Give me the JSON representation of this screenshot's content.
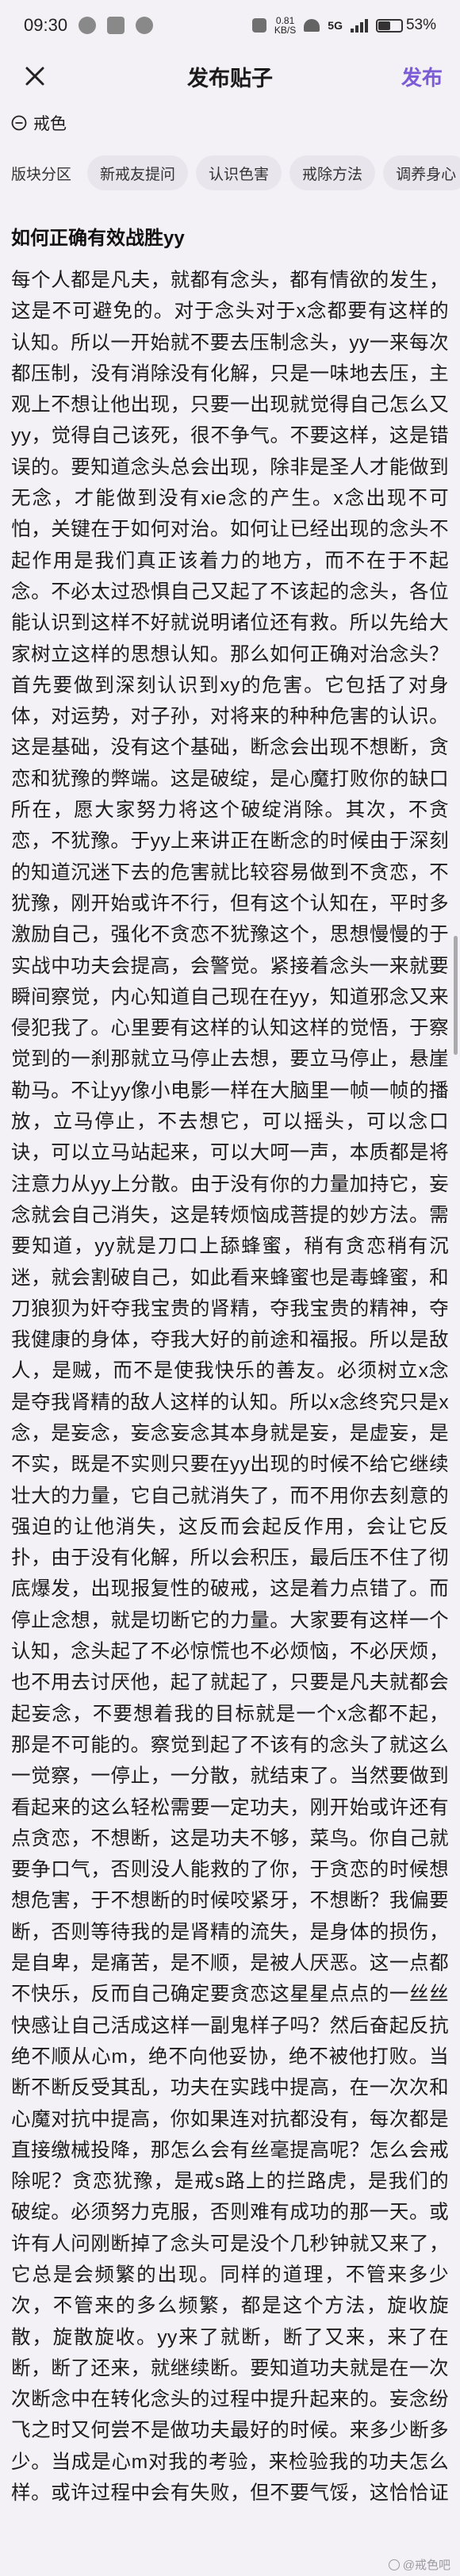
{
  "status_bar": {
    "time": "09:30",
    "net_speed_value": "0.81",
    "net_speed_unit": "KB/S",
    "network": "5G",
    "battery": "53%",
    "battery_level": 0.53
  },
  "header": {
    "title": "发布贴子",
    "publish_label": "发布"
  },
  "topic": {
    "label": "戒色"
  },
  "category": {
    "label": "版块分区",
    "chips": [
      "新戒友提问",
      "认识色害",
      "戒除方法",
      "调养身心"
    ]
  },
  "post": {
    "title": "如何正确有效战胜yy",
    "body": "每个人都是凡夫，就都有念头，都有情欲的发生，这是不可避免的。对于念头对于x念都要有这样的认知。所以一开始就不要去压制念头，yy一来每次都压制，没有消除没有化解，只是一味地去压，主观上不想让他出现，只要一出现就觉得自己怎么又yy，觉得自己该死，很不争气。不要这样，这是错误的。要知道念头总会出现，除非是圣人才能做到无念，才能做到没有xie念的产生。x念出现不可怕，关键在于如何对治。如何让已经出现的念头不起作用是我们真正该着力的地方，而不在于不起念。不必太过恐惧自己又起了不该起的念头，各位能认识到这样不好就说明诸位还有救。所以先给大家树立这样的思想认知。那么如何正确对治念头？首先要做到深刻认识到xy的危害。它包括了对身体，对运势，对子孙，对将来的种种危害的认识。这是基础，没有这个基础，断念会出现不想断，贪恋和犹豫的弊端。这是破绽，是心魔打败你的缺口所在，愿大家努力将这个破绽消除。其次，不贪恋，不犹豫。于yy上来讲正在断念的时候由于深刻的知道沉迷下去的危害就比较容易做到不贪恋，不犹豫，刚开始或许不行，但有这个认知在，平时多激励自己，强化不贪恋不犹豫这个，思想慢慢的于实战中功夫会提高，会警觉。紧接着念头一来就要瞬间察觉，内心知道自己现在在yy，知道邪念又来侵犯我了。心里要有这样的认知这样的觉悟，于察觉到的一刹那就立马停止去想，要立马停止，悬崖勒马。不让yy像小电影一样在大脑里一帧一帧的播放，立马停止，不去想它，可以摇头，可以念口诀，可以立马站起来，可以大呵一声，本质都是将注意力从yy上分散。由于没有你的力量加持它，妄念就会自己消失，这是转烦恼成菩提的妙方法。需要知道，yy就是刀口上舔蜂蜜，稍有贪恋稍有沉迷，就会割破自己，如此看来蜂蜜也是毒蜂蜜，和刀狼狈为奸夺我宝贵的肾精，夺我宝贵的精神，夺我健康的身体，夺我大好的前途和福报。所以是敌人，是贼，而不是使我快乐的善友。必须树立x念是夺我肾精的敌人这样的认知。所以x念终究只是x念，是妄念，妄念妄念其本身就是妄，是虚妄，是不实，既是不实则只要在yy出现的时候不给它继续壮大的力量，它自己就消失了，而不用你去刻意的强迫的让他消失，这反而会起反作用，会让它反扑，由于没有化解，所以会积压，最后压不住了彻底爆发，出现报复性的破戒，这是着力点错了。而停止念想，就是切断它的力量。大家要有这样一个认知，念头起了不必惊慌也不必烦恼，不必厌烦，也不用去讨厌他，起了就起了，只要是凡夫就都会起妄念，不要想着我的目标就是一个x念都不起，那是不可能的。察觉到起了不该有的念头了就这么一觉察，一停止，一分散，就结束了。当然要做到看起来的这么轻松需要一定功夫，刚开始或许还有点贪恋，不想断，这是功夫不够，菜鸟。你自己就要争口气，否则没人能救的了你，于贪恋的时候想想危害，于不想断的时候咬紧牙，不想断？我偏要断，否则等待我的是肾精的流失，是身体的损伤，是自卑，是痛苦，是不顺，是被人厌恶。这一点都不快乐，反而自己确定要贪恋这星星点点的一丝丝快感让自己活成这样一副鬼样子吗？然后奋起反抗绝不顺从心m，绝不向他妥协，绝不被他打败。当断不断反受其乱，功夫在实践中提高，在一次次和心魔对抗中提高，你如果连对抗都没有，每次都是直接缴械投降，那怎么会有丝毫提高呢？怎么会戒除呢？贪恋犹豫，是戒s路上的拦路虎，是我们的破绽。必须努力克服，否则难有成功的那一天。或许有人问刚断掉了念头可是没个几秒钟就又来了，它总是会频繁的出现。同样的道理，不管来多少次，不管来的多么频繁，都是这个方法，旋收旋散，旋散旋收。yy来了就断，断了又来，来了在断，断了还来，就继续断。要知道功夫就是在一次次断念中在转化念头的过程中提升起来的。妄念纷飞之时又何尝不是做功夫最好的时候。来多少断多少。当成是心m对我的考验，来检验我的功夫怎么样。或许过程中会有失败，但不要气馁，这恰恰证明你的功夫不够，振奋精神，于妄念纷飞中继续努力下去，时间一长功夫就得力。功夫一得力，不仅可以轻松将心m打败，心m知难而退，yy的次数和频率也会降低也会下去。心里会很清净。愿大家勉励。"
  },
  "watermark": {
    "text": "@戒色吧"
  }
}
